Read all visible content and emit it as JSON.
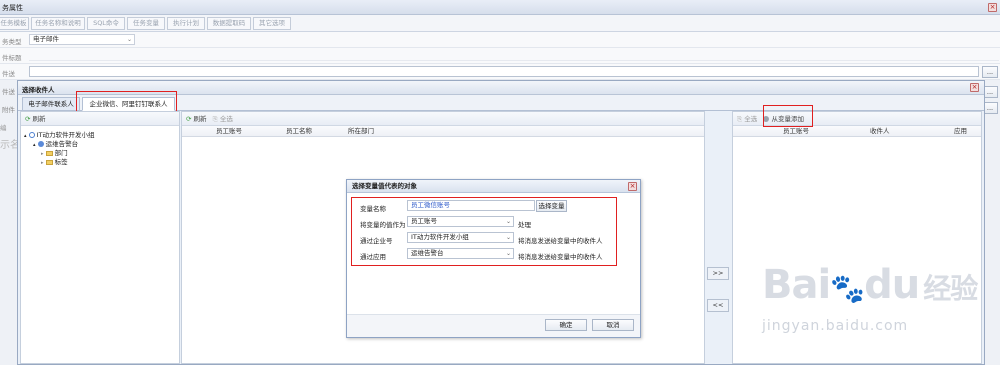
{
  "window": {
    "title": "务属性"
  },
  "tabs": [
    "任务模板",
    "任务名称和说明",
    "SQL命令",
    "任务变量",
    "执行计划",
    "数据提取码",
    "其它选项"
  ],
  "form": {
    "type_label": "务类型",
    "type_value": "电子邮件",
    "subject_label": "件标题",
    "row3_label": "件送",
    "row4_label": "件送",
    "row5_label": "附件"
  },
  "dialog": {
    "title": "选择收件人",
    "tab_email": "电子邮件联系人",
    "tab_wechat": "企业微信、阿里钉钉联系人",
    "left_refresh": "刷新",
    "tree": {
      "root": "IT动力软件开发小组",
      "child": "运维告警台",
      "leaf1": "部门",
      "leaf2": "标签"
    },
    "mid_refresh": "刷新",
    "mid_selectall": "全选",
    "mid_cols": [
      "员工账号",
      "员工名称",
      "所在部门"
    ],
    "right_selectall": "全选",
    "right_addvar": "从变量添加",
    "right_cols": [
      "员工账号",
      "收件人",
      "应用"
    ],
    "move_right": ">>",
    "move_left": "<<"
  },
  "modal": {
    "title": "选择变量值代表的对象",
    "var_label": "变量名称",
    "var_value": "员工微信账号",
    "select_var_btn": "选择变量",
    "treat_label": "将变量的值作为",
    "treat_value": "员工账号",
    "treat_suffix": "处理",
    "corp_label": "通过企业号",
    "corp_value": "IT动力软件开发小组",
    "corp_suffix": "将消息发送给变量中的收件人",
    "app_label": "通过应用",
    "app_value": "运维告警台",
    "app_suffix": "将消息发送给变量中的收件人",
    "ok": "确定",
    "cancel": "取消"
  },
  "side_text": {
    "edit": "编",
    "show": "示名"
  },
  "watermark": {
    "brand": "Bai",
    "brand2": "du",
    "brand3": "经验",
    "url": "jingyan.baidu.com"
  },
  "colors": {
    "accent": "#e02020",
    "link": "#2a57c9"
  }
}
